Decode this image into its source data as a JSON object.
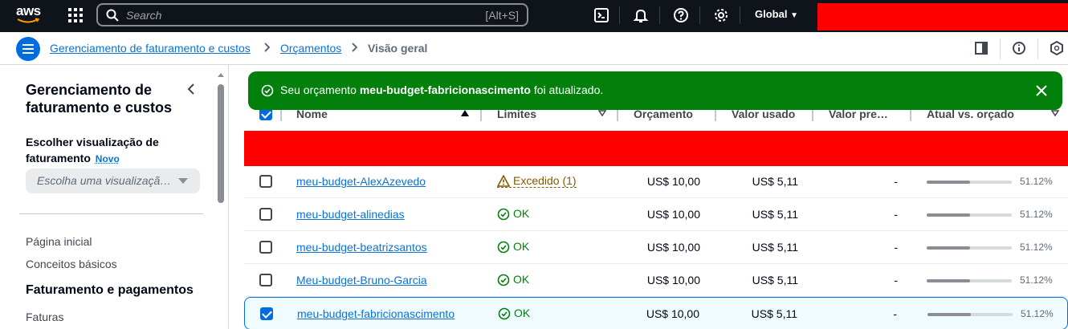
{
  "topnav": {
    "logo": "aws",
    "search_placeholder": "Search",
    "search_shortcut": "[Alt+S]",
    "region": "Global"
  },
  "breadcrumb": {
    "items": [
      "Gerenciamento de faturamento e custos",
      "Orçamentos"
    ],
    "current": "Visão geral"
  },
  "sidebar": {
    "title": "Gerenciamento de faturamento e custos",
    "view_label": "Escolher visualização de faturamento",
    "new_badge": "Novo",
    "select_placeholder": "Escolha uma visualizaçã…",
    "links": [
      "Página inicial",
      "Conceitos básicos"
    ],
    "section": "Faturamento e pagamentos",
    "sub_links": [
      "Faturas"
    ]
  },
  "flash": {
    "prefix": "Seu orçamento ",
    "budget": "meu-budget-fabricionascimento",
    "suffix": " foi atualizado.",
    "color": "#037f0c"
  },
  "table": {
    "headers": [
      "Nome",
      "Limites",
      "Orçamento",
      "Valor usado",
      "Valor pre…",
      "Atual vs. orçado"
    ],
    "rows": [
      {
        "name": "meu-budget-AlexAzevedo",
        "status": "Excedido (1)",
        "state": "warn",
        "budget": "US$ 10,00",
        "used": "US$ 5,11",
        "forecast": "-",
        "pct": "51.12%",
        "fraction": 0.5112,
        "checked": false
      },
      {
        "name": "meu-budget-alinedias",
        "status": "OK",
        "state": "ok",
        "budget": "US$ 10,00",
        "used": "US$ 5,11",
        "forecast": "-",
        "pct": "51.12%",
        "fraction": 0.5112,
        "checked": false
      },
      {
        "name": "meu-budget-beatrizsantos",
        "status": "OK",
        "state": "ok",
        "budget": "US$ 10,00",
        "used": "US$ 5,11",
        "forecast": "-",
        "pct": "51.12%",
        "fraction": 0.5112,
        "checked": false
      },
      {
        "name": "Meu-budget-Bruno-Garcia",
        "status": "OK",
        "state": "ok",
        "budget": "US$ 10,00",
        "used": "US$ 5,11",
        "forecast": "-",
        "pct": "51.12%",
        "fraction": 0.5112,
        "checked": false
      },
      {
        "name": "meu-budget-fabricionascimento",
        "status": "OK",
        "state": "ok",
        "budget": "US$ 10,00",
        "used": "US$ 5,11",
        "forecast": "-",
        "pct": "51.12%",
        "fraction": 0.5112,
        "checked": true
      }
    ]
  }
}
